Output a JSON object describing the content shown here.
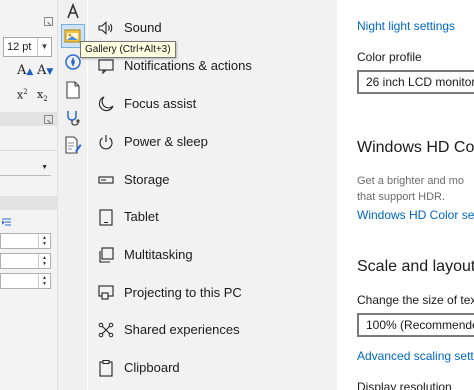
{
  "ribbon": {
    "font_size": "12 pt",
    "superscript": "x",
    "superscript_mark": "2",
    "subscript": "x",
    "subscript_mark": "2"
  },
  "tooltip": {
    "text": "Gallery (Ctrl+Alt+3)"
  },
  "nav": {
    "items": [
      {
        "label": "Sound",
        "icon": "speaker-icon"
      },
      {
        "label": "Notifications & actions",
        "icon": "notifications-icon"
      },
      {
        "label": "Focus assist",
        "icon": "moon-icon"
      },
      {
        "label": "Power & sleep",
        "icon": "power-icon"
      },
      {
        "label": "Storage",
        "icon": "storage-icon"
      },
      {
        "label": "Tablet",
        "icon": "tablet-icon"
      },
      {
        "label": "Multitasking",
        "icon": "multitasking-icon"
      },
      {
        "label": "Projecting to this PC",
        "icon": "projecting-icon"
      },
      {
        "label": "Shared experiences",
        "icon": "shared-experiences-icon"
      },
      {
        "label": "Clipboard",
        "icon": "clipboard-icon"
      }
    ]
  },
  "content": {
    "night_light_link": "Night light settings",
    "color_profile_label": "Color profile",
    "color_profile_value": "26 inch LCD monitor",
    "hd_color_heading": "Windows HD Col",
    "hd_color_desc_1": "Get a brighter and mo",
    "hd_color_desc_2": "that support HDR.",
    "hd_color_link": "Windows HD Color set",
    "scale_heading": "Scale and layout",
    "scale_label": "Change the size of tex",
    "scale_value": "100% (Recommended",
    "advanced_scaling_link": "Advanced scaling settin",
    "display_resolution_label": "Display resolution"
  },
  "colors": {
    "accent": "#0067c0",
    "nav_bg": "#f2f2f2",
    "tooltip_bg": "#ffffe1"
  }
}
